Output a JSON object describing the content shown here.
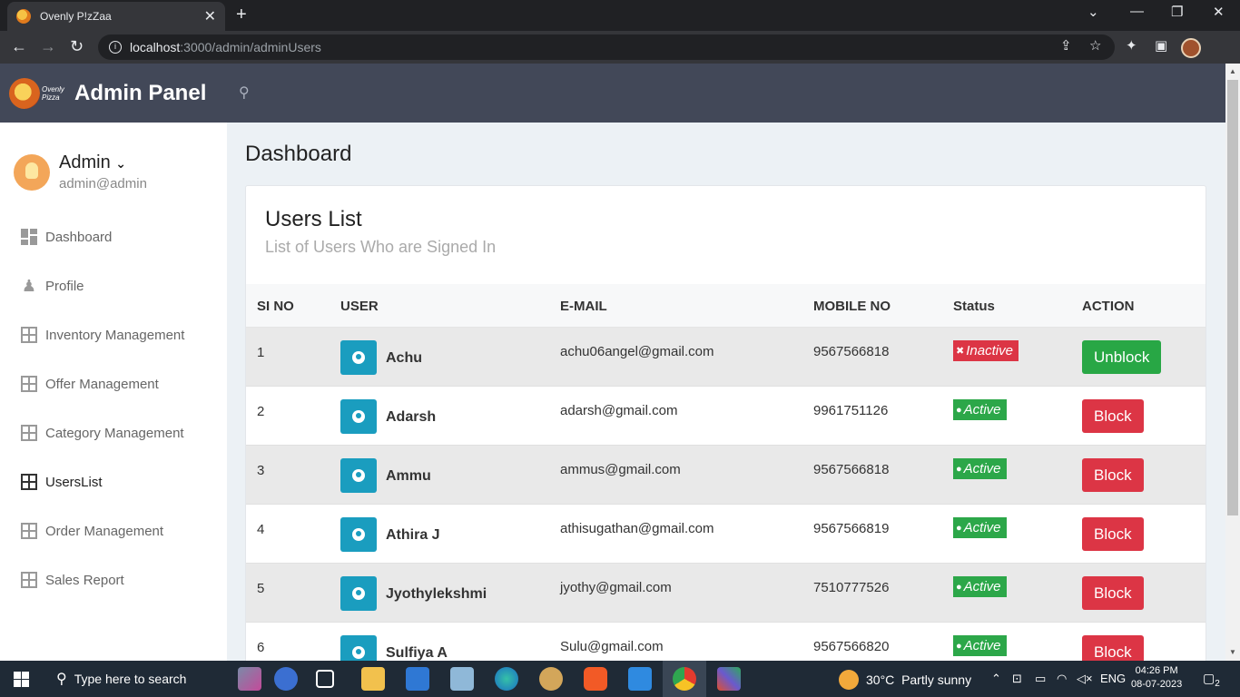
{
  "browser": {
    "tab_title": "Ovenly P!zZaa",
    "url_host": "localhost",
    "url_path": ":3000/admin/adminUsers"
  },
  "app": {
    "brand_script": "Ovenly Pizza",
    "brand_title": "Admin Panel"
  },
  "sidebar": {
    "profile_name": "Admin",
    "profile_email": "admin@admin",
    "items": [
      {
        "label": "Dashboard"
      },
      {
        "label": "Profile"
      },
      {
        "label": "Inventory Management"
      },
      {
        "label": "Offer Management"
      },
      {
        "label": "Category Management"
      },
      {
        "label": "UsersList"
      },
      {
        "label": "Order Management"
      },
      {
        "label": "Sales Report"
      }
    ]
  },
  "main": {
    "page_title": "Dashboard",
    "card_title": "Users List",
    "card_subtitle": "List of Users Who are Signed In",
    "columns": [
      "SI NO",
      "USER",
      "E-MAIL",
      "MOBILE NO",
      "Status",
      "ACTION"
    ],
    "rows": [
      {
        "no": "1",
        "user": "Achu",
        "email": "achu06angel@gmail.com",
        "mobile": "9567566818",
        "status": "Inactive",
        "action": "Unblock"
      },
      {
        "no": "2",
        "user": "Adarsh",
        "email": "adarsh@gmail.com",
        "mobile": "9961751126",
        "status": "Active",
        "action": "Block"
      },
      {
        "no": "3",
        "user": "Ammu",
        "email": "ammus@gmail.com",
        "mobile": "9567566818",
        "status": "Active",
        "action": "Block"
      },
      {
        "no": "4",
        "user": "Athira J",
        "email": "athisugathan@gmail.com",
        "mobile": "9567566819",
        "status": "Active",
        "action": "Block"
      },
      {
        "no": "5",
        "user": "Jyothylekshmi",
        "email": "jyothy@gmail.com",
        "mobile": "7510777526",
        "status": "Active",
        "action": "Block"
      },
      {
        "no": "6",
        "user": "Sulfiya A",
        "email": "Sulu@gmail.com",
        "mobile": "9567566820",
        "status": "Active",
        "action": "Block"
      }
    ]
  },
  "taskbar": {
    "search_placeholder": "Type here to search",
    "temperature": "30°C",
    "weather": "Partly sunny",
    "language": "ENG",
    "time": "04:26 PM",
    "date": "08-07-2023",
    "notifications": "2"
  },
  "colors": {
    "topbar": "#424858",
    "accent": "#1a9dbf",
    "active": "#2ca749",
    "danger": "#dc3545"
  }
}
